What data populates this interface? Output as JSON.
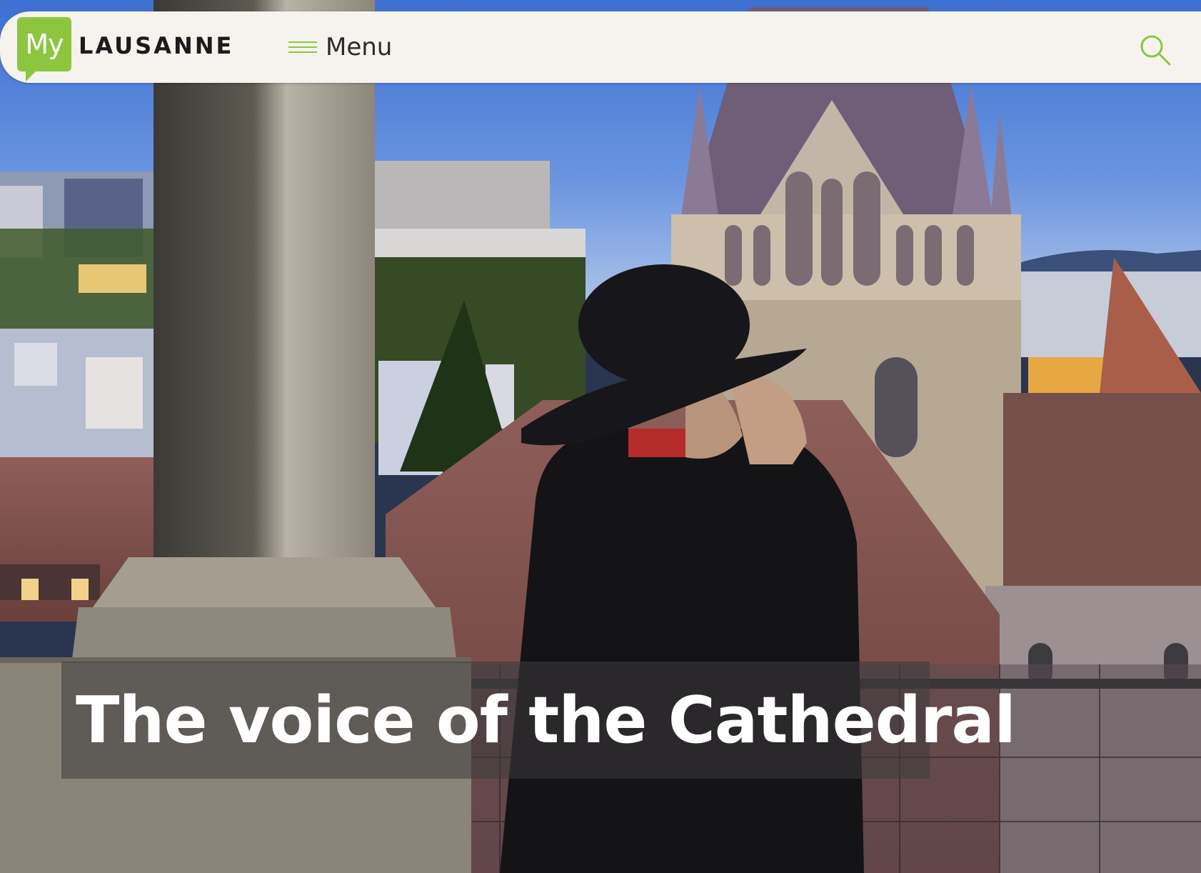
{
  "header": {
    "logo": {
      "badge_text": "My",
      "wordmark": "LAUSANNE"
    },
    "menu_label": "Menu",
    "search_icon": "search-icon"
  },
  "hero": {
    "title": "The voice of the Cathedral"
  },
  "colors": {
    "brand_green": "#8cc63f",
    "header_bg": "#f6f3ef",
    "title_text": "#ffffff"
  }
}
